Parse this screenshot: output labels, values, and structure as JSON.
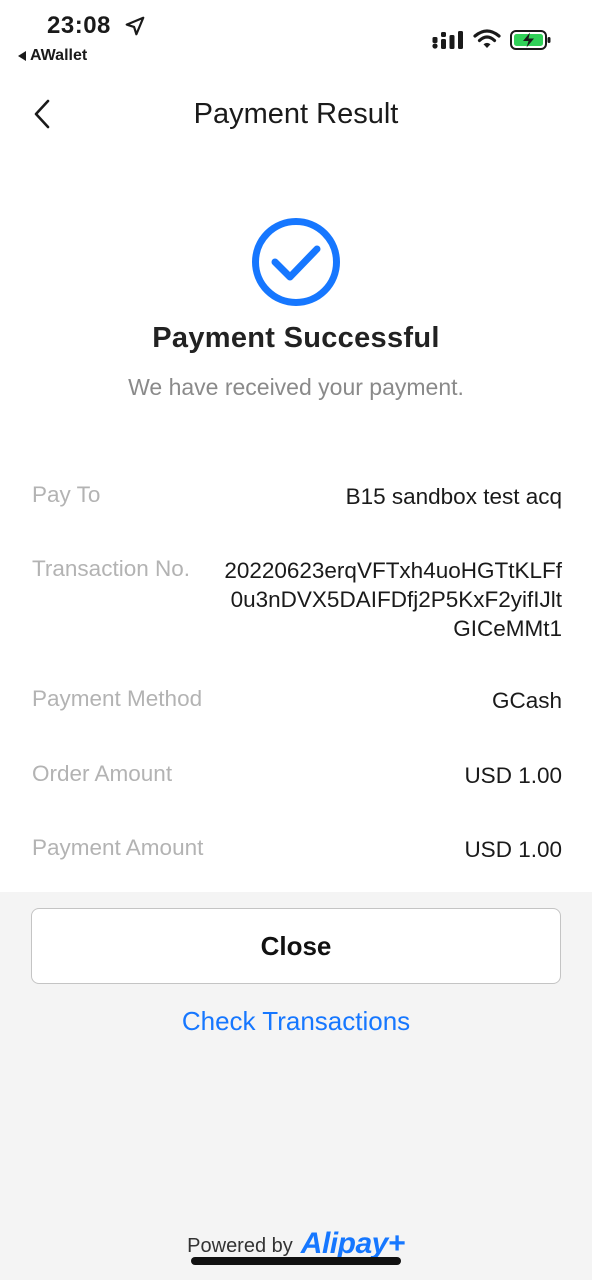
{
  "status_bar": {
    "time": "23:08",
    "back_app": "AWallet"
  },
  "nav": {
    "title": "Payment Result"
  },
  "result": {
    "title": "Payment Successful",
    "subtitle": "We have received your payment."
  },
  "details": [
    {
      "label": "Pay To",
      "value": "B15 sandbox test acq"
    },
    {
      "label": "Transaction No.",
      "value": "20220623erqVFTxh4uoHGTtKLFf0u3nDVX5DAIFDfj2P5KxF2yifIJltGICeMMt1"
    },
    {
      "label": "Payment Method",
      "value": "GCash"
    },
    {
      "label": "Order Amount",
      "value": "USD 1.00"
    },
    {
      "label": "Payment Amount",
      "value": "USD 1.00"
    }
  ],
  "actions": {
    "close_label": "Close",
    "check_label": "Check Transactions"
  },
  "footer": {
    "powered_by": "Powered by",
    "brand": "Alipay+"
  },
  "colors": {
    "accent": "#1677ff",
    "label_gray": "#b3b3b3",
    "footer_bg": "#f4f4f4"
  }
}
